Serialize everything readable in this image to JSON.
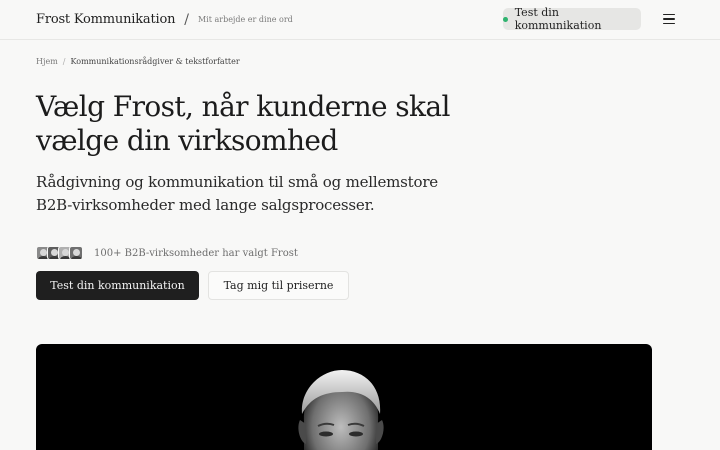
{
  "header": {
    "brand": "Frost Kommunikation",
    "separator": "/",
    "tagline": "Mit arbejde er dine ord",
    "cta_label": "Test din kommunikation",
    "status_color": "#2fb36f",
    "menu_icon": "hamburger-menu-icon"
  },
  "breadcrumb": {
    "home": "Hjem",
    "current": "Kommunikationsrådgiver & tekstforfatter"
  },
  "hero": {
    "title": "Vælg Frost, når kunderne skal vælge din virksomhed",
    "subtitle": "Rådgivning og kommunikation til små og mellemstore B2B-virksomheder med lange salgsprocesser.",
    "proof_text": "100+ B2B-virksomheder har valgt Frost",
    "primary_button": "Test din kommunikation",
    "secondary_button": "Tag mig til priserne"
  },
  "colors": {
    "background": "#f8f8f7",
    "primary_button": "#1f1f1f",
    "text": "#1c1c1c"
  }
}
